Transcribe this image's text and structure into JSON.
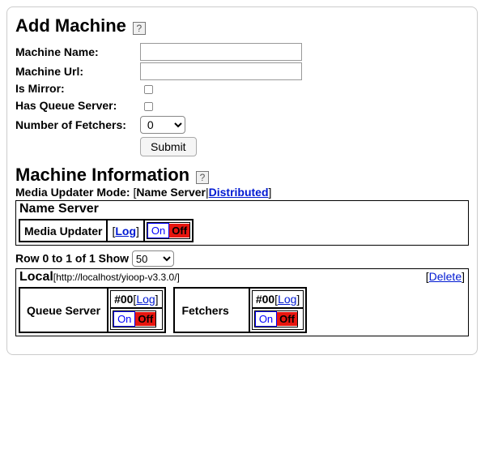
{
  "add": {
    "heading": "Add Machine",
    "machine_name_label": "Machine Name:",
    "machine_name_value": "",
    "machine_url_label": "Machine Url:",
    "machine_url_value": "",
    "is_mirror_label": "Is Mirror:",
    "is_mirror_checked": false,
    "has_queue_label": "Has Queue Server:",
    "has_queue_checked": false,
    "num_fetchers_label": "Number of Fetchers:",
    "num_fetchers_value": "0",
    "submit_label": "Submit"
  },
  "info": {
    "heading": "Machine Information",
    "mode_label": "Media Updater Mode:",
    "mode_name_server": "Name Server",
    "mode_distributed": "Distributed",
    "name_server": {
      "title": "Name Server",
      "media_updater_label": "Media Updater",
      "log_label": "Log",
      "on_label": "On",
      "off_label": "Off"
    },
    "pager": {
      "text": "Row 0 to 1 of 1 Show",
      "show_value": "50"
    },
    "local": {
      "title": "Local",
      "url": "[http://localhost/yioop-v3.3.0/]",
      "delete_label": "Delete",
      "queue_server": {
        "label": "Queue Server",
        "id_log": "#00",
        "log_label": "Log",
        "on_label": "On",
        "off_label": "Off"
      },
      "fetchers": {
        "label": "Fetchers",
        "id_log": "#00",
        "log_label": "Log",
        "on_label": "On",
        "off_label": "Off"
      }
    }
  }
}
